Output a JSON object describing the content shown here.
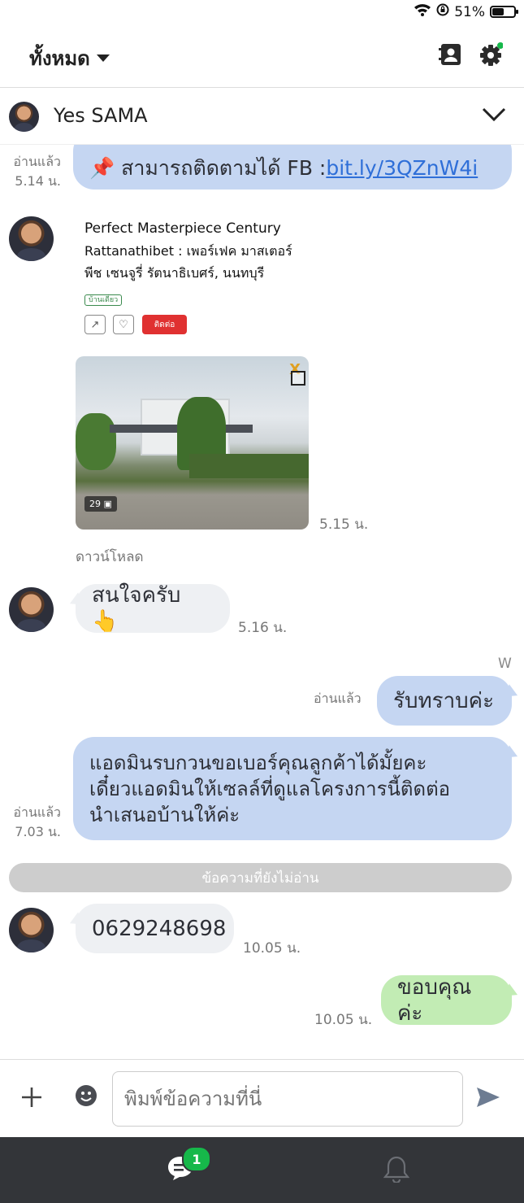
{
  "status_bar": {
    "battery": "51%",
    "battery_level": 0.51
  },
  "header": {
    "filter_label": "ทั้งหมด"
  },
  "chat": {
    "name": "Yes SAMA"
  },
  "messages": {
    "m1": {
      "text": "📌 สามารถติดตามได้ FB : ",
      "link": "bit.ly/3QZnW4i",
      "read": "อ่านแล้ว",
      "time": "5.14 น."
    },
    "card": {
      "title": "Perfect Masterpiece Century",
      "title_line2": "Rattanathibet : เพอร์เฟค มาสเตอร์",
      "title_line3": "พีช เซนจูรี่ รัตนาธิเบศร์, นนทบุรี",
      "tag": "บ้านเดี่ยว",
      "contact_button": "ติดต่อ",
      "photo_count": "29",
      "time": "5.15 น.",
      "download": "ดาวน์โหลด"
    },
    "m2": {
      "text": "สนใจครับ 👆",
      "time": "5.16 น."
    },
    "w_label": "W",
    "m3": {
      "text": "รับทราบค่ะ",
      "read": "อ่านแล้ว"
    },
    "m4": {
      "line1": "แอดมินรบกวนขอเบอร์คุณลูกค้าได้มั้ยคะ",
      "line2": "เดี๋ยวแอดมินให้เซลล์ที่ดูแลโครงการนี้ติดต่อ",
      "line3": "นำเสนอบ้านให้ค่ะ",
      "read": "อ่านแล้ว",
      "time": "7.03 น."
    },
    "unread_divider": "ข้อความที่ยังไม่อ่าน",
    "m5": {
      "text": "0629248698",
      "time": "10.05 น."
    },
    "m6": {
      "text": "ขอบคุณค่ะ",
      "time": "10.05 น."
    }
  },
  "input": {
    "placeholder": "พิมพ์ข้อความที่นี่"
  },
  "nav": {
    "chat_badge": "1"
  },
  "colors": {
    "outgoing": "#c5d6f2",
    "incoming": "#eef0f3",
    "sent_green": "#c2ecb4",
    "badge_green": "#16b84a",
    "link": "#2f6fd8"
  }
}
